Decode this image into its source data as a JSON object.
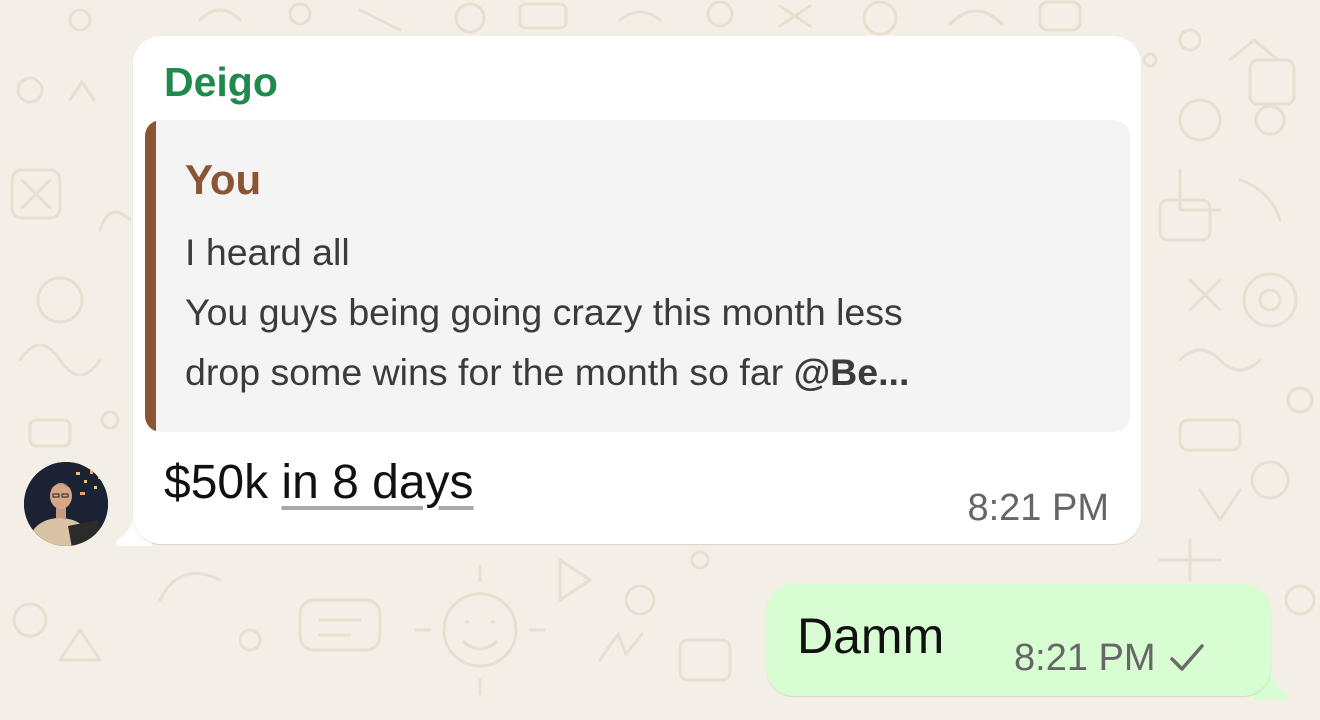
{
  "incoming_message": {
    "sender": "Deigo",
    "quoted": {
      "author": "You",
      "line_1": "I heard all",
      "line_2": "You guys being going crazy this month less",
      "line_3_text": "drop some wins for the month so far ",
      "line_3_mention": "@Be..."
    },
    "text_plain": "$50k ",
    "text_link": "in 8 days",
    "time": "8:21 PM"
  },
  "outgoing_message": {
    "text": "Damm",
    "time": "8:21 PM",
    "status_icon": "single-check-icon"
  },
  "colors": {
    "wallpaper": "#f4efe6",
    "incoming_bubble": "#ffffff",
    "outgoing_bubble": "#d9fdd3",
    "sender_name": "#1f8a4c",
    "quote_accent": "#8a5533",
    "quote_background": "#f5f4f4",
    "timestamp": "#666666"
  }
}
